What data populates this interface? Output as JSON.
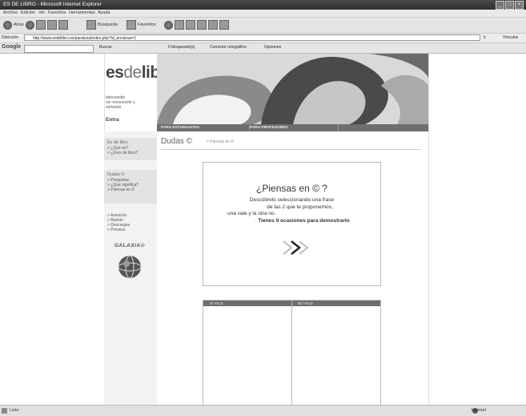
{
  "window": {
    "title": "ES DE LIBRO - Microsoft Internet Explorer",
    "controls": [
      "_",
      "□",
      "×"
    ]
  },
  "menu": [
    "Archivo",
    "Edición",
    "Ver",
    "Favoritos",
    "Herramientas",
    "Ayuda"
  ],
  "toolbar": {
    "back_label": "Atrás",
    "search_label": "Búsqueda",
    "favorites_label": "Favoritos"
  },
  "address": {
    "label": "Dirección",
    "url": "http://www.esdelibro.es/paraluxa/index.php?id_enviaras=1",
    "go_label": "Ir",
    "links_label": "Vínculos"
  },
  "google_bar": {
    "label": "Google",
    "search_button": "Buscar",
    "blocked_label": "0 bloqueado(s)",
    "spell_label": "Corrector ortográfico",
    "options_label": "Opciones"
  },
  "site": {
    "logo_main": "es",
    "logo_de": "de",
    "logo_libro": "libro",
    "tagline": [
      "bienvenido",
      "ser reconocido y",
      "sortearlo"
    ],
    "enter_link": "Entra",
    "nav_tabs": [
      "PARA ESTUDIANTES",
      "PARA PROFESORES"
    ]
  },
  "sidebar": {
    "section1": {
      "heading": "Es de libro",
      "items": [
        "> ¿Qué es?",
        "> ¿Eres de libro?"
      ]
    },
    "section2": {
      "heading": "Dudas ©",
      "items": [
        "> Preguntas",
        "> ¿Qué significa?",
        "> Piensas en ©"
      ]
    },
    "section3": {
      "items": [
        "> Asesoría",
        "> Boletín",
        "> Descargas",
        "> Premios"
      ]
    },
    "badge_text": "GALAXIA©"
  },
  "content": {
    "title": "Dudas ©",
    "subtitle": "> Piensas en ©",
    "quiz_question": "¿Piensas en © ?",
    "quiz_lines": [
      "Descúbrelo seleccionando una frase",
      "de las 2 que te proponemos,",
      "una vale y la otra no.",
      "Tienes 9 ocasiones para demostrarlo"
    ],
    "answer_headers": [
      "SI VALE",
      "NO VALE"
    ]
  },
  "status": {
    "text": "Listo",
    "zone": "Internet"
  }
}
